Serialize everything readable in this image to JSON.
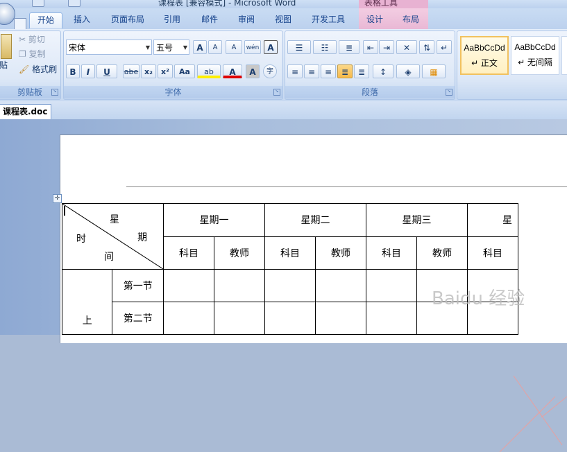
{
  "window": {
    "title": "课程表 [兼容模式] - Microsoft Word",
    "context_group_label": "表格工具"
  },
  "tabs": [
    {
      "label": "开始",
      "active": true
    },
    {
      "label": "插入"
    },
    {
      "label": "页面布局"
    },
    {
      "label": "引用"
    },
    {
      "label": "邮件"
    },
    {
      "label": "审阅"
    },
    {
      "label": "视图"
    },
    {
      "label": "开发工具"
    },
    {
      "label": "设计"
    },
    {
      "label": "布局"
    }
  ],
  "clipboard": {
    "paste_label": "贴",
    "cut": "剪切",
    "copy": "复制",
    "format_painter": "格式刷",
    "group_label": "剪贴板"
  },
  "font": {
    "font_name": "宋体",
    "font_size": "五号",
    "grow": "A",
    "shrink": "A",
    "clear": "A",
    "phonetic": "wén",
    "border_char": "A",
    "bold": "B",
    "italic": "I",
    "underline": "U",
    "strike": "abe",
    "subscript": "x₂",
    "superscript": "x²",
    "case": "Aa",
    "highlight": "ab",
    "font_color": "A",
    "shade_char": "A",
    "enclose": "字",
    "group_label": "字体"
  },
  "paragraph": {
    "group_label": "段落"
  },
  "styles": {
    "items": [
      {
        "preview": "AaBbCcDd",
        "name": "↵ 正文",
        "selected": true
      },
      {
        "preview": "AaBbCcDd",
        "name": "↵ 无间隔"
      }
    ]
  },
  "document_tab": "课程表.doc",
  "table": {
    "diag_header": {
      "top": "星",
      "middle_left": "时",
      "middle_right": "期",
      "bottom": "间"
    },
    "days": [
      "星期一",
      "星期二",
      "星期三",
      "星"
    ],
    "sub_headers": [
      "科目",
      "教师",
      "科目",
      "教师",
      "科目",
      "教师",
      "科目"
    ],
    "rows": [
      {
        "period_group": "",
        "period": "第一节"
      },
      {
        "period_group": "上",
        "period": "第二节"
      }
    ]
  },
  "watermark": "Baidu 经验",
  "colors": {
    "accent": "#15428b",
    "ribbon_bg": "#dfe9f7",
    "context_tab": "#e9b8d5"
  }
}
